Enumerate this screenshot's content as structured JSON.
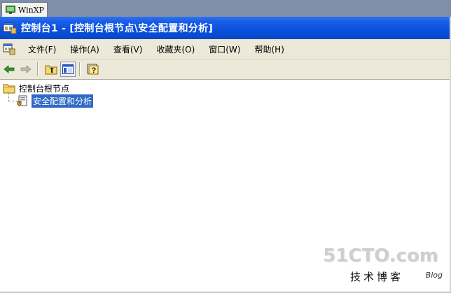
{
  "vm_tab": {
    "label": "WinXP",
    "icon": "vm-tab-icon"
  },
  "window": {
    "title": "控制台1 - [控制台根节点\\安全配置和分析]",
    "icon": "mmc-console-icon",
    "title_bar_color": "#0a50dc"
  },
  "menubar": {
    "items": [
      {
        "label": "文件(F)"
      },
      {
        "label": "操作(A)"
      },
      {
        "label": "查看(V)"
      },
      {
        "label": "收藏夹(O)"
      },
      {
        "label": "窗口(W)"
      },
      {
        "label": "帮助(H)"
      }
    ]
  },
  "toolbar": {
    "buttons": [
      {
        "icon": "back-arrow-icon"
      },
      {
        "icon": "forward-arrow-icon"
      },
      {
        "icon": "up-folder-icon"
      },
      {
        "icon": "show-hide-tree-icon",
        "pressed": true
      },
      {
        "icon": "help-icon"
      }
    ]
  },
  "tree": {
    "root": {
      "label": "控制台根节点",
      "icon": "folder-icon"
    },
    "child": {
      "label": "安全配置和分析",
      "icon": "security-config-icon",
      "selected": true,
      "selection_color": "#316ac5"
    }
  },
  "watermark": {
    "logo": "51CTO.com",
    "subtitle": "技术博客",
    "blog": "Blog"
  }
}
